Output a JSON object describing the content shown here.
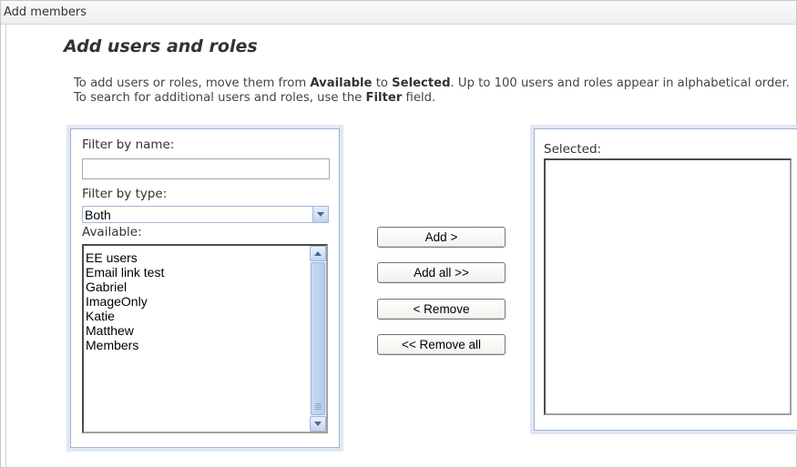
{
  "window": {
    "title": "Add members"
  },
  "page": {
    "heading": "Add users and roles",
    "instructions": {
      "p1": "To add users or roles, move them from ",
      "available_word": "Available",
      "p2": " to ",
      "selected_word": "Selected",
      "p3": ". Up to 100 users and roles appear in alphabetical order. To search for additional users and roles, use the ",
      "filter_word": "Filter",
      "p4": " field."
    }
  },
  "left_panel": {
    "filter_name_label": "Filter by name:",
    "filter_name_value": "",
    "filter_type_label": "Filter by type:",
    "filter_type_selected": "Both",
    "available_label": "Available:",
    "available_items": [
      "EE users",
      "Email link test",
      "Gabriel",
      "ImageOnly",
      "Katie",
      "Matthew",
      "Members"
    ]
  },
  "actions": {
    "add": "Add >",
    "add_all": "Add all >>",
    "remove": "< Remove",
    "remove_all": "<< Remove all"
  },
  "right_panel": {
    "selected_label": "Selected:",
    "selected_items": []
  },
  "icons": {
    "dropdown": "chevron-down-icon",
    "scroll_up": "scroll-up-arrow-icon",
    "scroll_down": "scroll-down-arrow-icon"
  }
}
